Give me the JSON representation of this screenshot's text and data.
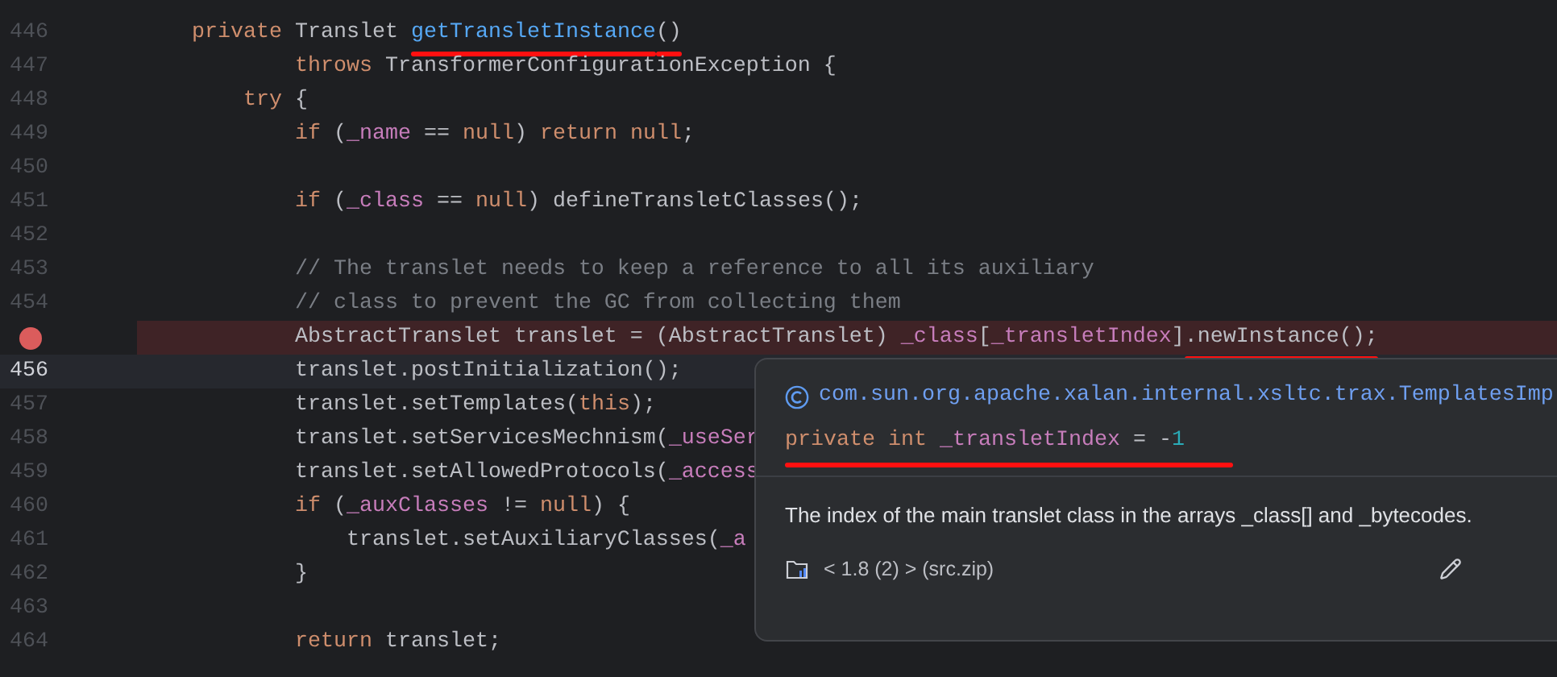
{
  "editor": {
    "lines": [
      {
        "number": "446",
        "tokens": [
          {
            "text": "    private",
            "kind": "keyword"
          },
          {
            "text": " Translet ",
            "kind": "plain"
          },
          {
            "text": "getTransletInstance",
            "kind": "declaration",
            "underlined": true
          },
          {
            "text": "()",
            "kind": "plain",
            "underlined": true
          }
        ]
      },
      {
        "number": "447",
        "tokens": [
          {
            "text": "            throws",
            "kind": "keyword"
          },
          {
            "text": " TransformerConfigurationException {",
            "kind": "plain"
          }
        ]
      },
      {
        "number": "448",
        "tokens": [
          {
            "text": "        try",
            "kind": "keyword"
          },
          {
            "text": " {",
            "kind": "plain"
          }
        ]
      },
      {
        "number": "449",
        "tokens": [
          {
            "text": "            if",
            "kind": "keyword"
          },
          {
            "text": " (",
            "kind": "plain"
          },
          {
            "text": "_name",
            "kind": "field"
          },
          {
            "text": " == ",
            "kind": "plain"
          },
          {
            "text": "null",
            "kind": "keyword"
          },
          {
            "text": ") ",
            "kind": "plain"
          },
          {
            "text": "return null",
            "kind": "keyword"
          },
          {
            "text": ";",
            "kind": "plain"
          }
        ]
      },
      {
        "number": "450"
      },
      {
        "number": "451",
        "tokens": [
          {
            "text": "            if",
            "kind": "keyword"
          },
          {
            "text": " (",
            "kind": "plain"
          },
          {
            "text": "_class",
            "kind": "field"
          },
          {
            "text": " == ",
            "kind": "plain"
          },
          {
            "text": "null",
            "kind": "keyword"
          },
          {
            "text": ") defineTransletClasses();",
            "kind": "plain"
          }
        ]
      },
      {
        "number": "452"
      },
      {
        "number": "453",
        "tokens": [
          {
            "text": "            // The translet needs to keep a reference to all its auxiliary",
            "kind": "comment"
          }
        ]
      },
      {
        "number": "454",
        "tokens": [
          {
            "text": "            // class to prevent the GC from collecting them",
            "kind": "comment"
          }
        ]
      },
      {
        "breakpoint": true,
        "tokens": [
          {
            "text": "            AbstractTranslet translet = (AbstractTranslet) ",
            "kind": "plain"
          },
          {
            "text": "_class",
            "kind": "field"
          },
          {
            "text": "[",
            "kind": "plain"
          },
          {
            "text": "_transletIndex",
            "kind": "field"
          },
          {
            "text": "]",
            "kind": "plain"
          },
          {
            "text": ".newInstance();",
            "kind": "plain",
            "underlined": true
          }
        ]
      },
      {
        "number": "456",
        "current": true,
        "tokens": [
          {
            "text": "            translet.postInitialization();",
            "kind": "plain"
          }
        ]
      },
      {
        "number": "457",
        "tokens": [
          {
            "text": "            translet.setTemplates(",
            "kind": "plain"
          },
          {
            "text": "this",
            "kind": "keyword"
          },
          {
            "text": ");",
            "kind": "plain"
          }
        ]
      },
      {
        "number": "458",
        "tokens": [
          {
            "text": "            translet.setServicesMechnism(",
            "kind": "plain"
          },
          {
            "text": "_useSer",
            "kind": "field"
          }
        ]
      },
      {
        "number": "459",
        "tokens": [
          {
            "text": "            translet.setAllowedProtocols(",
            "kind": "plain"
          },
          {
            "text": "_access",
            "kind": "field"
          }
        ]
      },
      {
        "number": "460",
        "tokens": [
          {
            "text": "            if",
            "kind": "keyword"
          },
          {
            "text": " (",
            "kind": "plain"
          },
          {
            "text": "_auxClasses",
            "kind": "field"
          },
          {
            "text": " != ",
            "kind": "plain"
          },
          {
            "text": "null",
            "kind": "keyword"
          },
          {
            "text": ") {",
            "kind": "plain"
          }
        ]
      },
      {
        "number": "461",
        "tokens": [
          {
            "text": "                translet.setAuxiliaryClasses(",
            "kind": "plain"
          },
          {
            "text": "_a",
            "kind": "field"
          }
        ]
      },
      {
        "number": "462",
        "tokens": [
          {
            "text": "            }",
            "kind": "plain"
          }
        ]
      },
      {
        "number": "463"
      },
      {
        "number": "464",
        "tokens": [
          {
            "text": "            return",
            "kind": "keyword"
          },
          {
            "text": " translet;",
            "kind": "plain"
          }
        ]
      }
    ]
  },
  "tooltip": {
    "class_name": "com.sun.org.apache.xalan.internal.xsltc.trax.TemplatesImp",
    "signature": {
      "underlined": true,
      "tokens": [
        {
          "text": "private int ",
          "kind": "keyword"
        },
        {
          "text": "_transletIndex",
          "kind": "field"
        },
        {
          "text": " = -",
          "kind": "plain"
        },
        {
          "text": "1",
          "kind": "number"
        }
      ]
    },
    "description": "The index of the main translet class in the arrays _class[] and _bytecodes.",
    "source": "< 1.8 (2) > (src.zip)"
  }
}
